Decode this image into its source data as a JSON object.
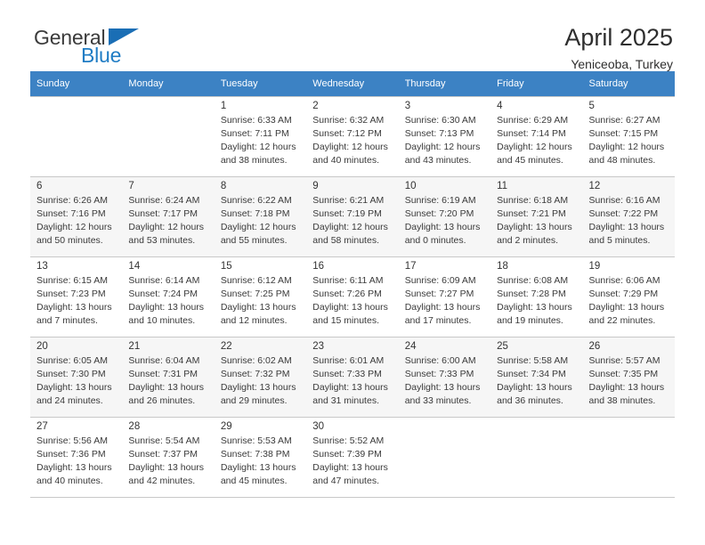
{
  "brand": {
    "name_part1": "General",
    "name_part2": "Blue",
    "accent_color": "#1a6eb5",
    "text_color": "#3b3b3b"
  },
  "header": {
    "title": "April 2025",
    "subtitle": "Yeniceoba, Turkey"
  },
  "calendar": {
    "header_bg": "#3c82c4",
    "weekday_headers": [
      "Sunday",
      "Monday",
      "Tuesday",
      "Wednesday",
      "Thursday",
      "Friday",
      "Saturday"
    ],
    "weeks": [
      [
        {
          "day": "",
          "info": ""
        },
        {
          "day": "",
          "info": ""
        },
        {
          "day": "1",
          "info": "Sunrise: 6:33 AM\nSunset: 7:11 PM\nDaylight: 12 hours\nand 38 minutes."
        },
        {
          "day": "2",
          "info": "Sunrise: 6:32 AM\nSunset: 7:12 PM\nDaylight: 12 hours\nand 40 minutes."
        },
        {
          "day": "3",
          "info": "Sunrise: 6:30 AM\nSunset: 7:13 PM\nDaylight: 12 hours\nand 43 minutes."
        },
        {
          "day": "4",
          "info": "Sunrise: 6:29 AM\nSunset: 7:14 PM\nDaylight: 12 hours\nand 45 minutes."
        },
        {
          "day": "5",
          "info": "Sunrise: 6:27 AM\nSunset: 7:15 PM\nDaylight: 12 hours\nand 48 minutes."
        }
      ],
      [
        {
          "day": "6",
          "info": "Sunrise: 6:26 AM\nSunset: 7:16 PM\nDaylight: 12 hours\nand 50 minutes."
        },
        {
          "day": "7",
          "info": "Sunrise: 6:24 AM\nSunset: 7:17 PM\nDaylight: 12 hours\nand 53 minutes."
        },
        {
          "day": "8",
          "info": "Sunrise: 6:22 AM\nSunset: 7:18 PM\nDaylight: 12 hours\nand 55 minutes."
        },
        {
          "day": "9",
          "info": "Sunrise: 6:21 AM\nSunset: 7:19 PM\nDaylight: 12 hours\nand 58 minutes."
        },
        {
          "day": "10",
          "info": "Sunrise: 6:19 AM\nSunset: 7:20 PM\nDaylight: 13 hours\nand 0 minutes."
        },
        {
          "day": "11",
          "info": "Sunrise: 6:18 AM\nSunset: 7:21 PM\nDaylight: 13 hours\nand 2 minutes."
        },
        {
          "day": "12",
          "info": "Sunrise: 6:16 AM\nSunset: 7:22 PM\nDaylight: 13 hours\nand 5 minutes."
        }
      ],
      [
        {
          "day": "13",
          "info": "Sunrise: 6:15 AM\nSunset: 7:23 PM\nDaylight: 13 hours\nand 7 minutes."
        },
        {
          "day": "14",
          "info": "Sunrise: 6:14 AM\nSunset: 7:24 PM\nDaylight: 13 hours\nand 10 minutes."
        },
        {
          "day": "15",
          "info": "Sunrise: 6:12 AM\nSunset: 7:25 PM\nDaylight: 13 hours\nand 12 minutes."
        },
        {
          "day": "16",
          "info": "Sunrise: 6:11 AM\nSunset: 7:26 PM\nDaylight: 13 hours\nand 15 minutes."
        },
        {
          "day": "17",
          "info": "Sunrise: 6:09 AM\nSunset: 7:27 PM\nDaylight: 13 hours\nand 17 minutes."
        },
        {
          "day": "18",
          "info": "Sunrise: 6:08 AM\nSunset: 7:28 PM\nDaylight: 13 hours\nand 19 minutes."
        },
        {
          "day": "19",
          "info": "Sunrise: 6:06 AM\nSunset: 7:29 PM\nDaylight: 13 hours\nand 22 minutes."
        }
      ],
      [
        {
          "day": "20",
          "info": "Sunrise: 6:05 AM\nSunset: 7:30 PM\nDaylight: 13 hours\nand 24 minutes."
        },
        {
          "day": "21",
          "info": "Sunrise: 6:04 AM\nSunset: 7:31 PM\nDaylight: 13 hours\nand 26 minutes."
        },
        {
          "day": "22",
          "info": "Sunrise: 6:02 AM\nSunset: 7:32 PM\nDaylight: 13 hours\nand 29 minutes."
        },
        {
          "day": "23",
          "info": "Sunrise: 6:01 AM\nSunset: 7:33 PM\nDaylight: 13 hours\nand 31 minutes."
        },
        {
          "day": "24",
          "info": "Sunrise: 6:00 AM\nSunset: 7:33 PM\nDaylight: 13 hours\nand 33 minutes."
        },
        {
          "day": "25",
          "info": "Sunrise: 5:58 AM\nSunset: 7:34 PM\nDaylight: 13 hours\nand 36 minutes."
        },
        {
          "day": "26",
          "info": "Sunrise: 5:57 AM\nSunset: 7:35 PM\nDaylight: 13 hours\nand 38 minutes."
        }
      ],
      [
        {
          "day": "27",
          "info": "Sunrise: 5:56 AM\nSunset: 7:36 PM\nDaylight: 13 hours\nand 40 minutes."
        },
        {
          "day": "28",
          "info": "Sunrise: 5:54 AM\nSunset: 7:37 PM\nDaylight: 13 hours\nand 42 minutes."
        },
        {
          "day": "29",
          "info": "Sunrise: 5:53 AM\nSunset: 7:38 PM\nDaylight: 13 hours\nand 45 minutes."
        },
        {
          "day": "30",
          "info": "Sunrise: 5:52 AM\nSunset: 7:39 PM\nDaylight: 13 hours\nand 47 minutes."
        },
        {
          "day": "",
          "info": ""
        },
        {
          "day": "",
          "info": ""
        },
        {
          "day": "",
          "info": ""
        }
      ]
    ]
  }
}
